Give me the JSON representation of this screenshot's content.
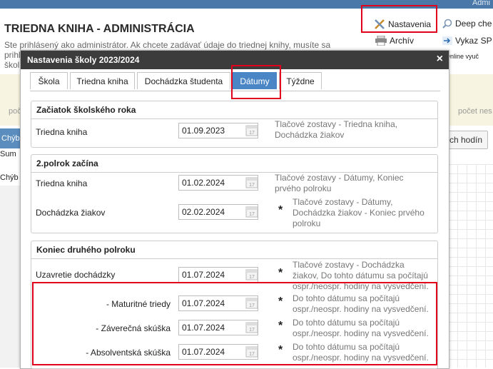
{
  "topbar": {
    "admin": "Admi"
  },
  "app": {
    "title": "TRIEDNA KNIHA - ADMINISTRÁCIA",
    "note_line1": "Ste prihlásený ako administrátor. Ak chcete zadávať údaje do triednej knihy, musíte sa",
    "note_line2": "prihl",
    "note_line3": "škol"
  },
  "menu": {
    "settings": "Nastavenia",
    "archive": "Archív",
    "deep": "Deep che",
    "vykaz": "Vykaz SP",
    "online": "Online vyuč"
  },
  "background": {
    "band_left": "poč",
    "band_right": "počet nes",
    "side_tab": "Chýb",
    "side_sum": "Sum",
    "side_chyb2": "Chýb",
    "hodin_button": "ch hodín"
  },
  "modal": {
    "title": "Nastavenia školy 2023/2024",
    "close": "×",
    "tabs": [
      {
        "label": "Škola"
      },
      {
        "label": "Triedna kniha"
      },
      {
        "label": "Dochádzka študenta"
      },
      {
        "label": "Dátumy"
      },
      {
        "label": "Týždne"
      }
    ],
    "sections": {
      "start": {
        "title": "Začiatok školského roka",
        "rows": [
          {
            "label": "Triedna kniha",
            "value": "01.09.2023",
            "star": "",
            "desc1": "Tlačové zostavy - Triedna kniha,",
            "desc2": "Dochádzka žiakov",
            "desc3": ""
          }
        ]
      },
      "semester2": {
        "title": "2.polrok začína",
        "rows": [
          {
            "label": "Triedna kniha",
            "value": "01.02.2024",
            "star": "",
            "desc1": "Tlačové zostavy - Dátumy, Koniec",
            "desc2": "prvého polroku",
            "desc3": ""
          },
          {
            "label": "Dochádzka žiakov",
            "value": "02.02.2024",
            "star": "*",
            "desc1": "Tlačové zostavy - Dátumy,",
            "desc2": "Dochádzka žiakov - Koniec prvého",
            "desc3": "polroku"
          }
        ]
      },
      "end": {
        "title": "Koniec druhého polroku",
        "rows": [
          {
            "label": "Uzavretie dochádzky",
            "value": "01.07.2024",
            "star": "*",
            "desc1": "Tlačové zostavy - Dochádzka",
            "desc2": "žiakov, Do tohto dátumu sa počítajú",
            "desc3": "ospr./neospr. hodiny na vysvedčení."
          },
          {
            "label": "- Maturitné triedy",
            "value": "01.07.2024",
            "star": "*",
            "desc1": "Do tohto dátumu sa počítajú",
            "desc2": "ospr./neospr. hodiny na vysvedčení.",
            "desc3": ""
          },
          {
            "label": "- Záverečná skúška",
            "value": "01.07.2024",
            "star": "*",
            "desc1": "Do tohto dátumu sa počítajú",
            "desc2": "ospr./neospr. hodiny na vysvedčení.",
            "desc3": ""
          },
          {
            "label": "- Absolventská skúška",
            "value": "01.07.2024",
            "star": "*",
            "desc1": "Do tohto dátumu sa počítajú",
            "desc2": "ospr./neospr. hodiny na vysvedčení.",
            "desc3": ""
          }
        ]
      }
    }
  },
  "colors": {
    "accent": "#4a86c5",
    "header": "#3c3c3c",
    "highlight": "#e0001b"
  }
}
